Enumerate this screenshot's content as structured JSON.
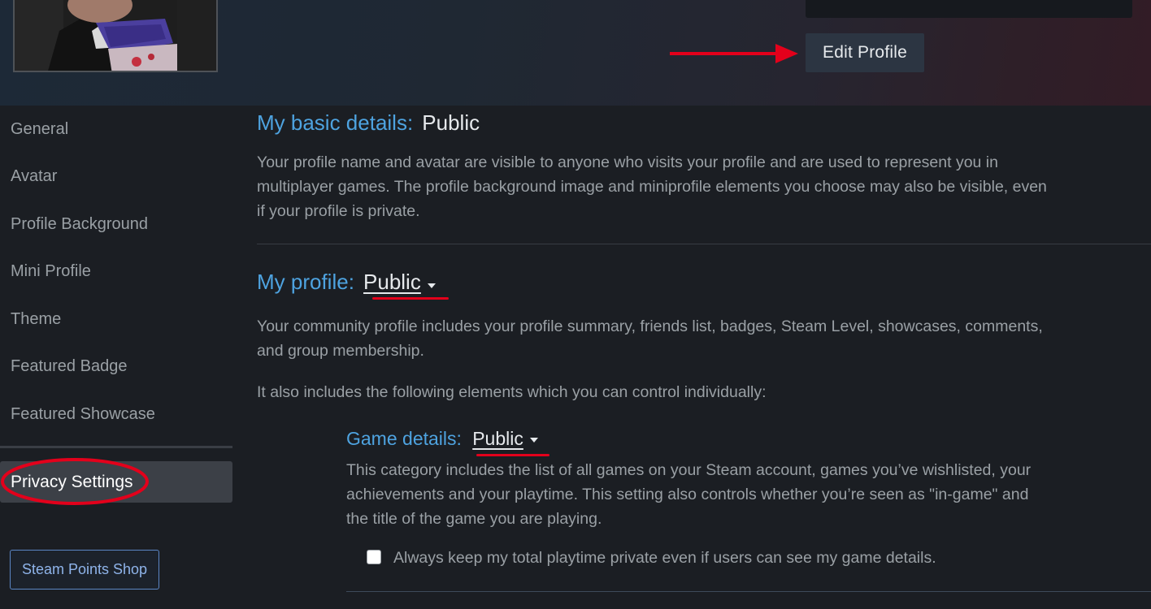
{
  "header": {
    "edit_profile_label": "Edit Profile"
  },
  "sidebar": {
    "items": [
      {
        "label": "General"
      },
      {
        "label": "Avatar"
      },
      {
        "label": "Profile Background"
      },
      {
        "label": "Mini Profile"
      },
      {
        "label": "Theme"
      },
      {
        "label": "Featured Badge"
      },
      {
        "label": "Featured Showcase"
      }
    ],
    "active_item": "Privacy Settings",
    "points_shop_label": "Steam Points Shop"
  },
  "main": {
    "basic_details": {
      "label": "My basic details:",
      "value": "Public",
      "desc_lines": [
        "Your profile name and avatar are visible to anyone who visits your profile and are used to represent you in",
        "multiplayer games. The profile background image and miniprofile elements you choose may also be visible, even",
        "if your profile is private."
      ]
    },
    "my_profile": {
      "label": "My profile:",
      "value": "Public",
      "desc_lines": [
        "Your community profile includes your profile summary, friends list, badges, Steam Level, showcases, comments,",
        "and group membership."
      ],
      "also_text": "It also includes the following elements which you can control individually:"
    },
    "game_details": {
      "label": "Game details:",
      "value": "Public",
      "desc_lines": [
        "This category includes the list of all games on your Steam account, games you’ve wishlisted, your",
        "achievements and your playtime. This setting also controls whether you’re seen as \"in-game\" and",
        "the title of the game you are playing."
      ],
      "checkbox_label": "Always keep my total playtime private even if users can see my game details.",
      "checkbox_checked": false
    }
  },
  "colors": {
    "accent_blue": "#4ea3e0",
    "annotation_red": "#e3001b",
    "background": "#1b1e23"
  }
}
